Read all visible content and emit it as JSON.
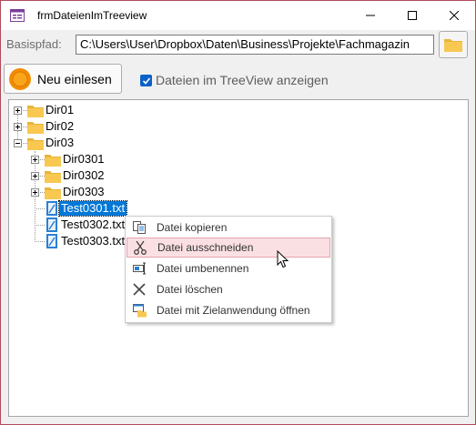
{
  "window": {
    "title": "frmDateienImTreeview"
  },
  "form": {
    "basispfad_label": "Basispfad:",
    "basispfad_value": "C:\\Users\\User\\Dropbox\\Daten\\Business\\Projekte\\Fachmagazin",
    "reload_button": "Neu einlesen",
    "checkbox_label": "Dateien im TreeView anzeigen",
    "checkbox_checked": true
  },
  "tree": {
    "nodes": [
      {
        "label": "Dir01",
        "type": "folder",
        "expander": "+"
      },
      {
        "label": "Dir02",
        "type": "folder",
        "expander": "+"
      },
      {
        "label": "Dir03",
        "type": "folder",
        "expander": "-"
      },
      {
        "label": "Dir0301",
        "type": "folder",
        "expander": "+"
      },
      {
        "label": "Dir0302",
        "type": "folder",
        "expander": "+"
      },
      {
        "label": "Dir0303",
        "type": "folder",
        "expander": "+"
      },
      {
        "label": "Test0301.txt",
        "type": "file",
        "selected": true
      },
      {
        "label": "Test0302.txt",
        "type": "file"
      },
      {
        "label": "Test0303.txt",
        "type": "file"
      }
    ]
  },
  "context_menu": {
    "items": [
      {
        "label": "Datei kopieren",
        "icon": "copy-icon"
      },
      {
        "label": "Datei ausschneiden",
        "icon": "scissors-icon",
        "hover": true
      },
      {
        "label": "Datei umbenennen",
        "icon": "rename-icon"
      },
      {
        "label": "Datei löschen",
        "icon": "delete-x-icon"
      },
      {
        "label": "Datei mit Zielanwendung öffnen",
        "icon": "open-with-icon"
      }
    ]
  },
  "colors": {
    "accent": "#0078d7",
    "hover_bg": "#fbe0e3",
    "folder": "#f8c851"
  }
}
